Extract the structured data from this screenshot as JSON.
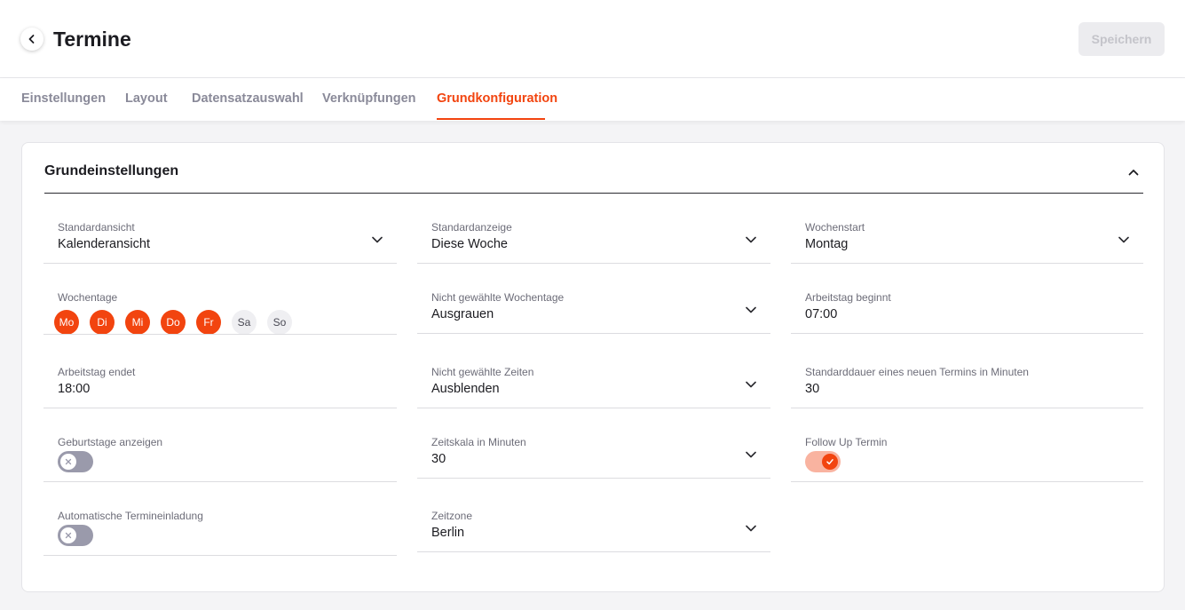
{
  "header": {
    "title": "Termine",
    "save_label": "Speichern"
  },
  "tabs": [
    {
      "label": "Einstellungen",
      "active": false
    },
    {
      "label": "Layout",
      "active": false
    },
    {
      "label": "Datensatzauswahl",
      "active": false
    },
    {
      "label": "Verknüpfungen",
      "active": false
    },
    {
      "label": "Grundkonfiguration",
      "active": true
    }
  ],
  "section": {
    "title": "Grundeinstellungen",
    "expanded": true
  },
  "fields": {
    "standardansicht": {
      "label": "Standardansicht",
      "value": "Kalenderansicht"
    },
    "standardanzeige": {
      "label": "Standardanzeige",
      "value": "Diese Woche"
    },
    "wochenstart": {
      "label": "Wochenstart",
      "value": "Montag"
    },
    "wochentage": {
      "label": "Wochentage",
      "days": [
        {
          "label": "Mo",
          "selected": true
        },
        {
          "label": "Di",
          "selected": true
        },
        {
          "label": "Mi",
          "selected": true
        },
        {
          "label": "Do",
          "selected": true
        },
        {
          "label": "Fr",
          "selected": true
        },
        {
          "label": "Sa",
          "selected": false
        },
        {
          "label": "So",
          "selected": false
        }
      ]
    },
    "nicht_gewaehlte_wochentage": {
      "label": "Nicht gewählte Wochentage",
      "value": "Ausgrauen"
    },
    "arbeitstag_beginnt": {
      "label": "Arbeitstag beginnt",
      "value": "07:00"
    },
    "arbeitstag_endet": {
      "label": "Arbeitstag endet",
      "value": "18:00"
    },
    "nicht_gewaehlte_zeiten": {
      "label": "Nicht gewählte Zeiten",
      "value": "Ausblenden"
    },
    "standarddauer": {
      "label": "Standarddauer eines neuen Termins in Minuten",
      "value": "30"
    },
    "geburtstage_anzeigen": {
      "label": "Geburtstage anzeigen",
      "enabled": false
    },
    "zeitskala": {
      "label": "Zeitskala in Minuten",
      "value": "30"
    },
    "follow_up_termin": {
      "label": "Follow Up Termin",
      "enabled": true
    },
    "automatische_termineinladung": {
      "label": "Automatische Termineinladung",
      "enabled": false
    },
    "zeitzone": {
      "label": "Zeitzone",
      "value": "Berlin"
    }
  },
  "colors": {
    "accent": "#f2440f",
    "toggle_off": "#9a9aab",
    "toggle_on_track": "#f9b3a0"
  },
  "icons": {
    "back": "chevron-left-icon",
    "collapse": "chevron-up-icon",
    "dropdown": "chevron-down-icon",
    "toggle_off": "close-icon",
    "toggle_on": "check-icon"
  }
}
